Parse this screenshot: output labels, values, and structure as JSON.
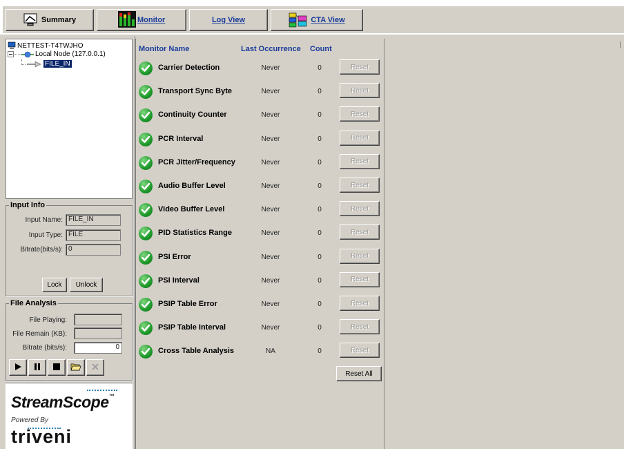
{
  "toolbar": {
    "summary_label": "Summary",
    "monitor_label": "Monitor",
    "logview_label": "Log View",
    "ctaview_label": "CTA View"
  },
  "tree": {
    "root": "NETTEST-T4TWJHO",
    "node": "Local Node (127.0.0.1)",
    "input": "FILE_IN"
  },
  "input_info": {
    "title": "Input Info",
    "name_label": "Input Name:",
    "name_value": "FILE_IN",
    "type_label": "Input Type:",
    "type_value": "FILE",
    "bitrate_label": "Bitrate(bits/s):",
    "bitrate_value": "0",
    "lock_label": "Lock",
    "unlock_label": "Unlock"
  },
  "file_analysis": {
    "title": "File Analysis",
    "playing_label": "File Playing:",
    "playing_value": "",
    "remain_label": "File Remain (KB):",
    "remain_value": "",
    "bitrate_label": "Bitrate (bits/s):",
    "bitrate_value": "0"
  },
  "branding": {
    "product": "StreamScope",
    "tm": "™",
    "powered_by": "Powered By",
    "company": "triveni"
  },
  "monitor": {
    "col_name": "Monitor Name",
    "col_last": "Last Occurrence",
    "col_count": "Count",
    "reset_label": "Reset",
    "reset_all_label": "Reset All",
    "rows": [
      {
        "name": "Carrier Detection",
        "last": "Never",
        "count": "0"
      },
      {
        "name": "Transport Sync Byte",
        "last": "Never",
        "count": "0"
      },
      {
        "name": "Continuity Counter",
        "last": "Never",
        "count": "0"
      },
      {
        "name": "PCR Interval",
        "last": "Never",
        "count": "0"
      },
      {
        "name": "PCR Jitter/Frequency",
        "last": "Never",
        "count": "0"
      },
      {
        "name": "Audio Buffer Level",
        "last": "Never",
        "count": "0"
      },
      {
        "name": "Video Buffer Level",
        "last": "Never",
        "count": "0"
      },
      {
        "name": "PID Statistics Range",
        "last": "Never",
        "count": "0"
      },
      {
        "name": "PSI Error",
        "last": "Never",
        "count": "0"
      },
      {
        "name": "PSI Interval",
        "last": "Never",
        "count": "0"
      },
      {
        "name": "PSIP Table Error",
        "last": "Never",
        "count": "0"
      },
      {
        "name": "PSIP Table Interval",
        "last": "Never",
        "count": "0"
      },
      {
        "name": "Cross Table Analysis",
        "last": "NA",
        "count": "0"
      }
    ]
  },
  "colors": {
    "chrome": "#d4d0c8",
    "link_blue": "#1a3c9a",
    "status_ok": "#1e9a2a",
    "selection": "#0a246a"
  },
  "icons": {
    "summary": "summary-monitor-icon",
    "monitor": "bar-meter-icon",
    "cta": "cta-stack-icon",
    "status": "check-circle-icon"
  }
}
